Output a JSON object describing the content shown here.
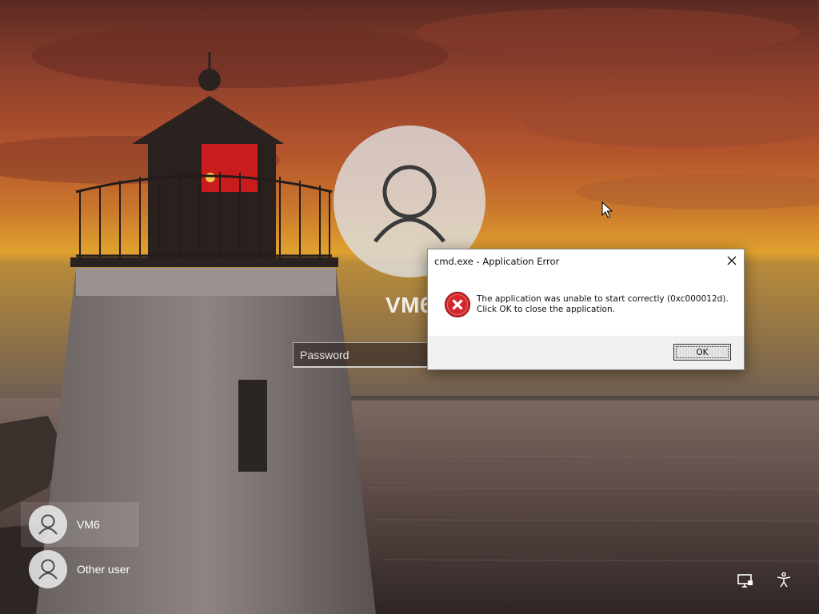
{
  "lock_screen": {
    "account_name": "VM6",
    "password_placeholder": "Password"
  },
  "users": [
    {
      "name": "VM6",
      "selected": true
    },
    {
      "name": "Other user",
      "selected": false
    }
  ],
  "corner_icons": [
    "network-icon",
    "accessibility-icon"
  ],
  "dialog": {
    "title": "cmd.exe - Application Error",
    "message_line1": "The application was unable to start correctly (0xc000012d).",
    "message_line2": "Click OK to close the application.",
    "ok_label": "OK",
    "icon": "error-icon"
  },
  "colors": {
    "error_red": "#d1282e",
    "dialog_footer": "#f0f0f0"
  }
}
